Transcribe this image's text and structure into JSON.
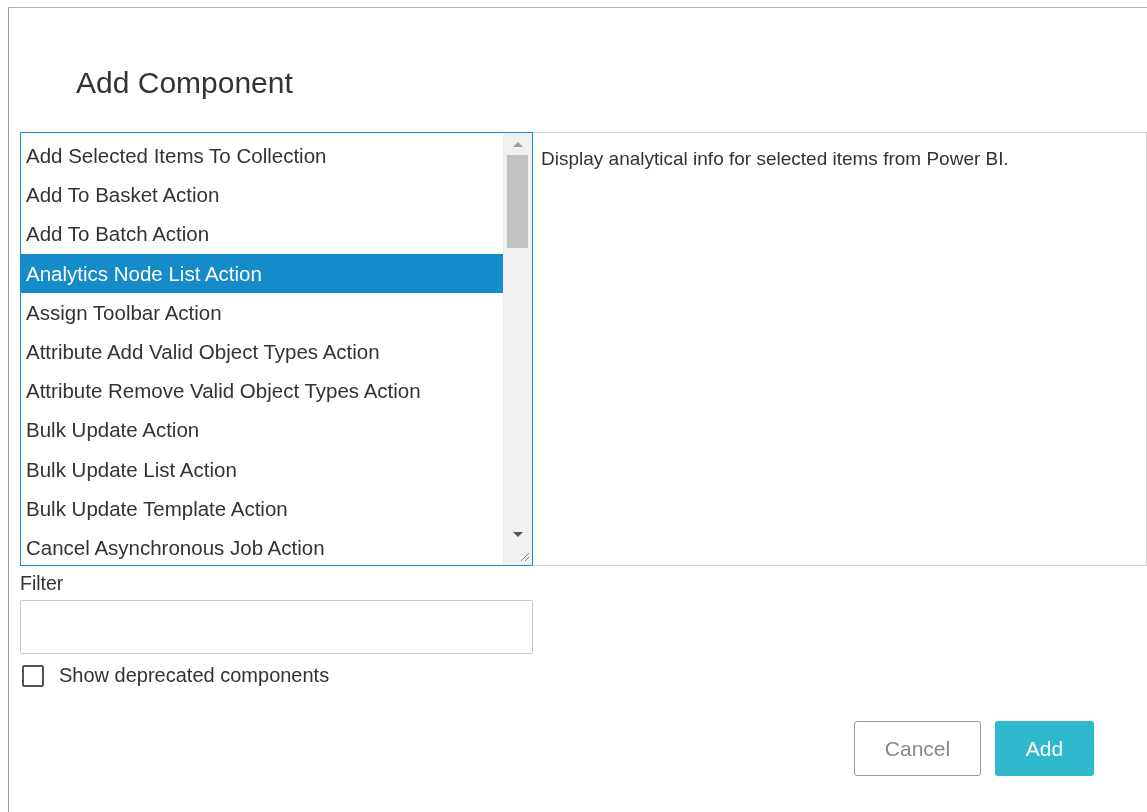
{
  "dialog": {
    "title": "Add Component"
  },
  "components": [
    {
      "label": "Add Selected Items To Collection",
      "selected": false
    },
    {
      "label": "Add To Basket Action",
      "selected": false
    },
    {
      "label": "Add To Batch Action",
      "selected": false
    },
    {
      "label": "Analytics Node List Action",
      "selected": true
    },
    {
      "label": "Assign Toolbar Action",
      "selected": false
    },
    {
      "label": "Attribute Add Valid Object Types Action",
      "selected": false
    },
    {
      "label": "Attribute Remove Valid Object Types Action",
      "selected": false
    },
    {
      "label": "Bulk Update Action",
      "selected": false
    },
    {
      "label": "Bulk Update List Action",
      "selected": false
    },
    {
      "label": "Bulk Update Template Action",
      "selected": false
    },
    {
      "label": "Cancel Asynchronous Job Action",
      "selected": false
    }
  ],
  "description": "Display analytical info for selected items from Power BI.",
  "filter": {
    "label": "Filter"
  },
  "show_deprecated": {
    "label": "Show deprecated components",
    "checked": false
  },
  "buttons": [
    {
      "label": "Cancel",
      "kind": "secondary"
    },
    {
      "label": "Add",
      "kind": "primary"
    }
  ]
}
